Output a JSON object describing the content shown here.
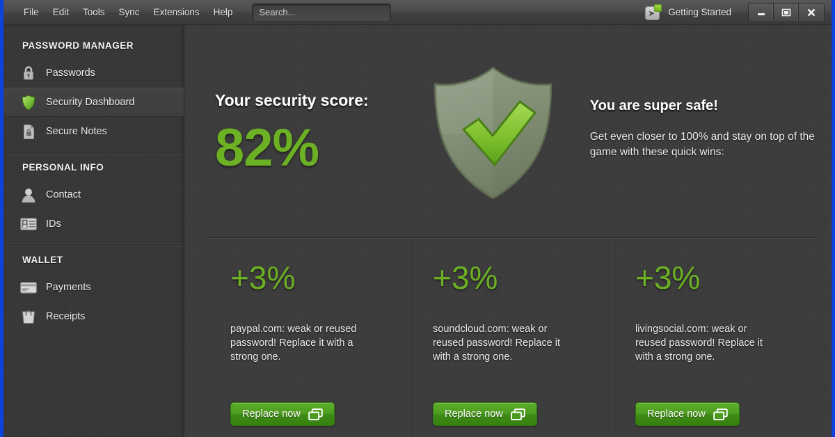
{
  "window": {
    "frame_color": "#0d43dd",
    "accent_green": "#6cb023"
  },
  "menubar": {
    "items": [
      {
        "label": "File"
      },
      {
        "label": "Edit"
      },
      {
        "label": "Tools"
      },
      {
        "label": "Sync"
      },
      {
        "label": "Extensions"
      },
      {
        "label": "Help"
      }
    ],
    "search": {
      "value": "",
      "placeholder": "Search..."
    },
    "getting_started": {
      "label": "Getting Started",
      "icon": "arrow-right-badge-icon"
    },
    "window_controls": [
      {
        "name": "minimize",
        "icon": "minimize-icon"
      },
      {
        "name": "maximize",
        "icon": "maximize-icon"
      },
      {
        "name": "close",
        "icon": "close-icon"
      }
    ]
  },
  "sidebar": {
    "sections": [
      {
        "title": "PASSWORD MANAGER",
        "items": [
          {
            "label": "Passwords",
            "icon": "lock-icon",
            "active": false
          },
          {
            "label": "Security Dashboard",
            "icon": "shield-icon",
            "active": true
          },
          {
            "label": "Secure Notes",
            "icon": "note-lock-icon",
            "active": false
          }
        ]
      },
      {
        "title": "PERSONAL INFO",
        "items": [
          {
            "label": "Contact",
            "icon": "person-icon",
            "active": false
          },
          {
            "label": "IDs",
            "icon": "id-card-icon",
            "active": false
          }
        ]
      },
      {
        "title": "WALLET",
        "items": [
          {
            "label": "Payments",
            "icon": "credit-card-icon",
            "active": false
          },
          {
            "label": "Receipts",
            "icon": "receipt-bag-icon",
            "active": false
          }
        ]
      }
    ]
  },
  "main": {
    "score": {
      "title": "Your security score:",
      "value": "82%"
    },
    "shield": {
      "icon": "shield-check-icon"
    },
    "message": {
      "title": "You are super safe!",
      "body": "Get even closer to 100% and stay on top of the game with these quick wins:"
    },
    "cards": [
      {
        "gain": "+3%",
        "text": "paypal.com: weak or reused password! Replace it with a strong one.",
        "button_label": "Replace now",
        "button_icon": "windows-copy-icon"
      },
      {
        "gain": "+3%",
        "text": "soundcloud.com: weak or reused password! Replace it with a strong one.",
        "button_label": "Replace now",
        "button_icon": "windows-copy-icon"
      },
      {
        "gain": "+3%",
        "text": "livingsocial.com: weak or reused password! Replace it with a strong one.",
        "button_label": "Replace now",
        "button_icon": "windows-copy-icon"
      }
    ]
  }
}
